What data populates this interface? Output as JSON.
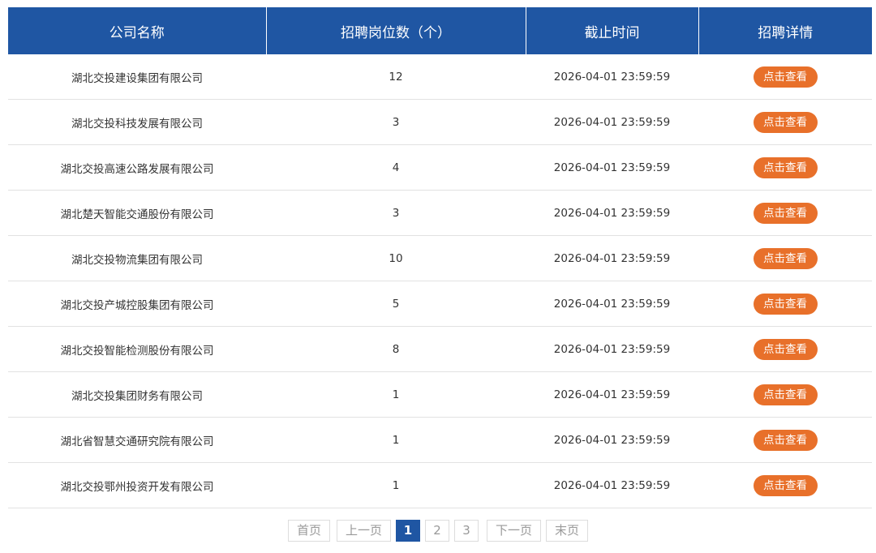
{
  "table": {
    "headers": {
      "company": "公司名称",
      "positions": "招聘岗位数（个）",
      "deadline": "截止时间",
      "details": "招聘详情"
    },
    "rows": [
      {
        "company": "湖北交投建设集团有限公司",
        "positions": "12",
        "deadline": "2026-04-01 23:59:59",
        "action": "点击查看"
      },
      {
        "company": "湖北交投科技发展有限公司",
        "positions": "3",
        "deadline": "2026-04-01 23:59:59",
        "action": "点击查看"
      },
      {
        "company": "湖北交投高速公路发展有限公司",
        "positions": "4",
        "deadline": "2026-04-01 23:59:59",
        "action": "点击查看"
      },
      {
        "company": "湖北楚天智能交通股份有限公司",
        "positions": "3",
        "deadline": "2026-04-01 23:59:59",
        "action": "点击查看"
      },
      {
        "company": "湖北交投物流集团有限公司",
        "positions": "10",
        "deadline": "2026-04-01 23:59:59",
        "action": "点击查看"
      },
      {
        "company": "湖北交投产城控股集团有限公司",
        "positions": "5",
        "deadline": "2026-04-01 23:59:59",
        "action": "点击查看"
      },
      {
        "company": "湖北交投智能检测股份有限公司",
        "positions": "8",
        "deadline": "2026-04-01 23:59:59",
        "action": "点击查看"
      },
      {
        "company": "湖北交投集团财务有限公司",
        "positions": "1",
        "deadline": "2026-04-01 23:59:59",
        "action": "点击查看"
      },
      {
        "company": "湖北省智慧交通研究院有限公司",
        "positions": "1",
        "deadline": "2026-04-01 23:59:59",
        "action": "点击查看"
      },
      {
        "company": "湖北交投鄂州投资开发有限公司",
        "positions": "1",
        "deadline": "2026-04-01 23:59:59",
        "action": "点击查看"
      }
    ]
  },
  "pagination": {
    "first": "首页",
    "prev": "上一页",
    "pages": [
      "1",
      "2",
      "3"
    ],
    "current_page": "1",
    "next": "下一页",
    "last": "末页"
  },
  "colors": {
    "header_bg": "#1f56a3",
    "button_bg": "#e8702a",
    "current_page_bg": "#1f56a3"
  }
}
